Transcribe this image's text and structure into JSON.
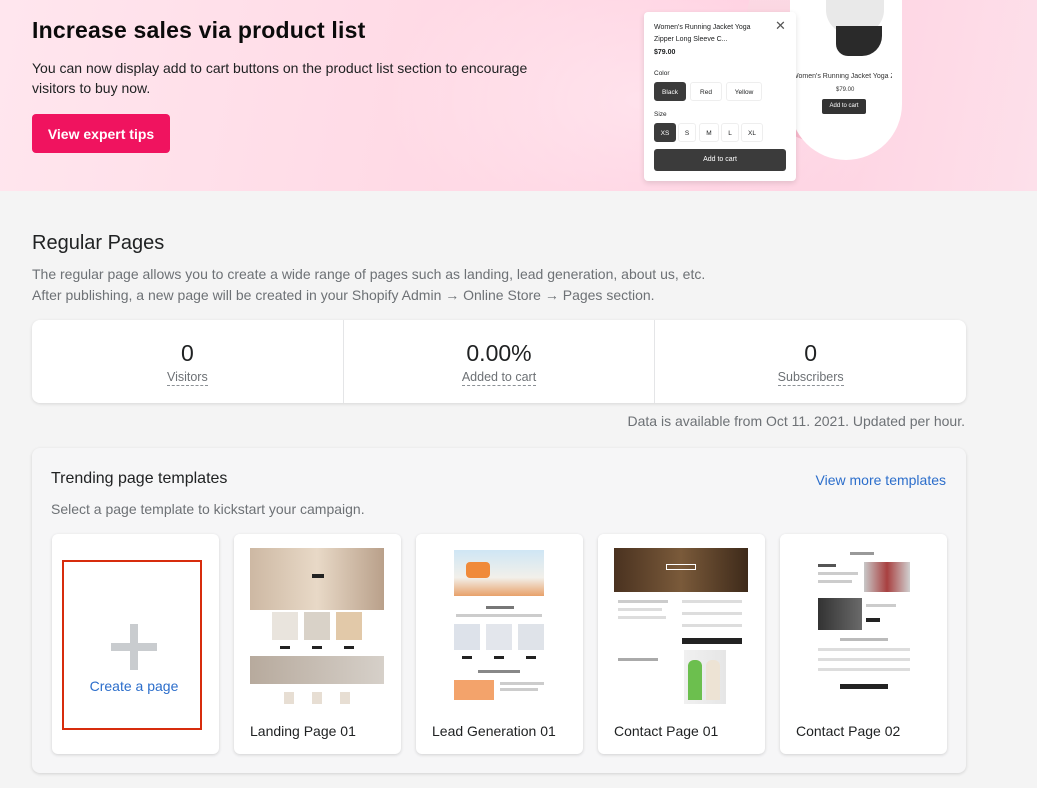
{
  "banner": {
    "title": "Increase sales via product list",
    "description": "You can now display add to cart buttons on the product list section to encourage visitors to buy now.",
    "cta_label": "View expert tips",
    "popup": {
      "product_name": "Women's Running Jacket Yoga Zipper Long Sleeve C...",
      "price": "$79.00",
      "color_label": "Color",
      "colors": [
        "Black",
        "Red",
        "Yellow"
      ],
      "size_label": "Size",
      "sizes": [
        "XS",
        "S",
        "M",
        "L",
        "XL"
      ],
      "add_to_cart": "Add to cart",
      "close_icon": "close-icon"
    },
    "back_card": {
      "product_name": "Women's Running Jacket Yoga Zippe",
      "price": "$79.00",
      "add_to_cart": "Add to cart"
    },
    "accent": "#f0135f"
  },
  "regular_pages": {
    "title": "Regular Pages",
    "desc_line1": "The regular page allows you to create a wide range of pages such as landing, lead generation, about us, etc.",
    "desc_line2": "After publishing, a new page will be created in your Shopify Admin → Online Store → Pages section."
  },
  "stats": [
    {
      "value": "0",
      "label": "Visitors"
    },
    {
      "value": "0.00%",
      "label": "Added to cart"
    },
    {
      "value": "0",
      "label": "Subscribers"
    }
  ],
  "data_note": "Data is available from Oct 11. 2021. Updated per hour.",
  "templates": {
    "title": "Trending page templates",
    "more_link": "View more templates",
    "description": "Select a page template to kickstart your campaign.",
    "create_label": "Create a page",
    "items": [
      "Landing Page 01",
      "Lead Generation 01",
      "Contact Page 01",
      "Contact Page 02"
    ]
  }
}
